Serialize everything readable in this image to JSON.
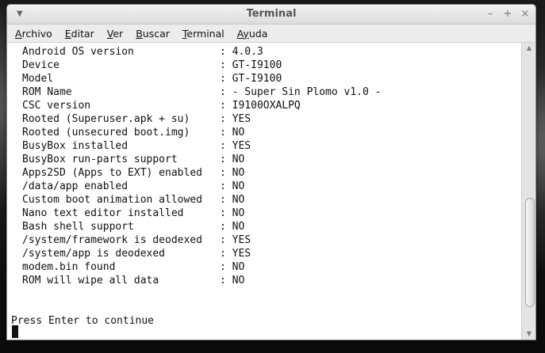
{
  "window": {
    "title": "Terminal",
    "controls": {
      "minimize": "–",
      "maximize": "+",
      "close": "×"
    }
  },
  "menubar": {
    "items": [
      {
        "accel": "A",
        "rest": "rchivo"
      },
      {
        "accel": "E",
        "rest": "ditar"
      },
      {
        "accel": "V",
        "rest": "er"
      },
      {
        "accel": "B",
        "rest": "uscar"
      },
      {
        "accel": "T",
        "rest": "erminal"
      },
      {
        "accel": "Ay",
        "rest": "uda"
      }
    ]
  },
  "terminal": {
    "rows": [
      {
        "label": "Android OS version",
        "value": ": 4.0.3"
      },
      {
        "label": "Device",
        "value": ": GT-I9100"
      },
      {
        "label": "Model",
        "value": ": GT-I9100"
      },
      {
        "label": "ROM Name",
        "value": ": - Super Sin Plomo v1.0 -"
      },
      {
        "label": "CSC version",
        "value": ": I9100OXALPQ"
      },
      {
        "label": "Rooted (Superuser.apk + su)",
        "value": ": YES"
      },
      {
        "label": "Rooted (unsecured boot.img)",
        "value": ": NO"
      },
      {
        "label": "BusyBox installed",
        "value": ": YES"
      },
      {
        "label": "BusyBox run-parts support",
        "value": ": NO"
      },
      {
        "label": "Apps2SD (Apps to EXT) enabled",
        "value": ": NO"
      },
      {
        "label": "/data/app enabled",
        "value": ": NO"
      },
      {
        "label": "Custom boot animation allowed",
        "value": ": NO"
      },
      {
        "label": "Nano text editor installed",
        "value": ": NO"
      },
      {
        "label": "Bash shell support",
        "value": ": NO"
      },
      {
        "label": "/system/framework is deodexed",
        "value": ": YES"
      },
      {
        "label": "/system/app is deodexed",
        "value": ": YES"
      },
      {
        "label": "modem.bin found",
        "value": ": NO"
      },
      {
        "label": "ROM will wipe all data",
        "value": ": NO"
      }
    ],
    "prompt": "Press Enter to continue"
  }
}
